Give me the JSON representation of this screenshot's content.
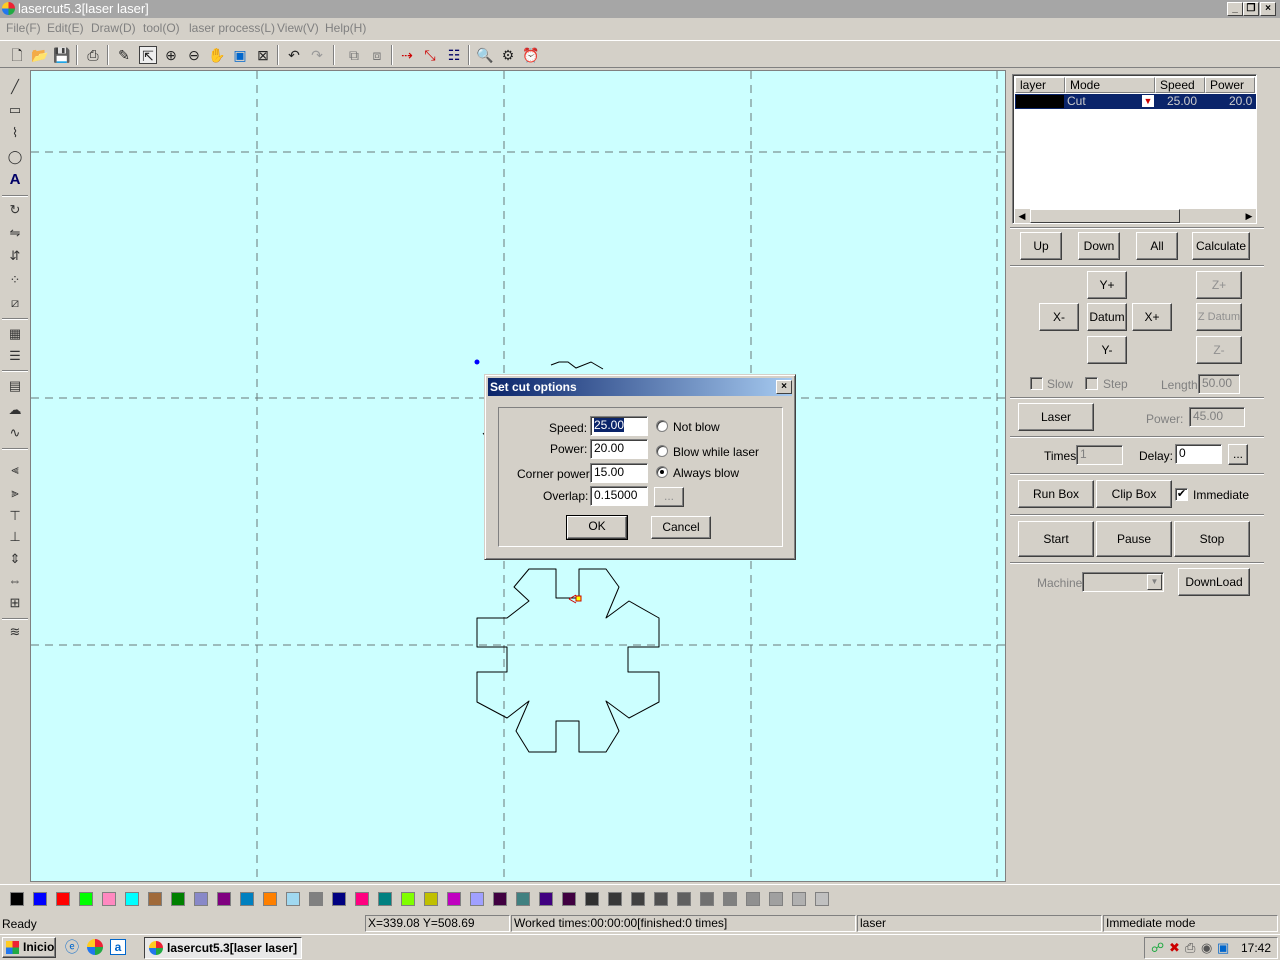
{
  "window": {
    "title": "lasercut5.3[laser laser]"
  },
  "menu": [
    "File(F)",
    "Edit(E)",
    "Draw(D)",
    "tool(O)",
    "laser process(L)",
    "View(V)",
    "Help(H)"
  ],
  "layer_table": {
    "headers": [
      "layer",
      "Mode",
      "Speed",
      "Power"
    ],
    "rows": [
      {
        "layer_color": "#000000",
        "mode": "Cut",
        "speed": "25.00",
        "power": "20.0"
      }
    ]
  },
  "controls": {
    "up": "Up",
    "down": "Down",
    "all": "All",
    "calculate": "Calculate",
    "y_plus": "Y+",
    "x_minus": "X-",
    "datum": "Datum",
    "x_plus": "X+",
    "y_minus": "Y-",
    "z_plus": "Z+",
    "z_datum": "Z Datum",
    "z_minus": "Z-",
    "slow": "Slow",
    "step": "Step",
    "length_label": "Length:",
    "length_value": "50.00",
    "laser": "Laser",
    "power_label": "Power:",
    "power_value": "45.00",
    "times_label": "Times:",
    "times_value": "1",
    "delay_label": "Delay:",
    "delay_value": "0",
    "delay_more": "...",
    "run_box": "Run Box",
    "clip_box": "Clip Box",
    "immediate": "Immediate",
    "start": "Start",
    "pause": "Pause",
    "stop": "Stop",
    "machine_label": "Machine:",
    "download": "DownLoad"
  },
  "dialog": {
    "title": "Set cut options",
    "speed_label": "Speed:",
    "speed_value": "25.00",
    "power_label": "Power:",
    "power_value": "20.00",
    "corner_power_label": "Corner power:",
    "corner_power_value": "15.00",
    "overlap_label": "Overlap:",
    "overlap_value": "0.15000",
    "more": "...",
    "not_blow": "Not blow",
    "blow_while_laser": "Blow while laser",
    "always_blow": "Always blow",
    "selected_blow": "always_blow",
    "ok": "OK",
    "cancel": "Cancel"
  },
  "status": {
    "ready": "Ready",
    "coords": "X=339.08 Y=508.69",
    "worked": "Worked times:00:00:00[finished:0 times]",
    "device": "laser",
    "mode": "Immediate mode"
  },
  "taskbar": {
    "start": "Inicio",
    "task": "lasercut5.3[laser laser]",
    "clock": "17:42"
  },
  "palette": [
    "#000000",
    "#0000ff",
    "#ff0000",
    "#00ff00",
    "#ff88c0",
    "#00ffff",
    "#a06a3a",
    "#008000",
    "#8888c8",
    "#800080",
    "#0080c0",
    "#ff8000",
    "#a0d8f0",
    "#808080",
    "#000080",
    "#ff0080",
    "#008080",
    "#80ff00",
    "#c0c000",
    "#c000c0",
    "#a0a0ff",
    "#400040",
    "#408080",
    "#400080",
    "#400040",
    "#303030",
    "#383838",
    "#404040",
    "#505050",
    "#606060",
    "#707070",
    "#808080",
    "#909090",
    "#a0a0a0",
    "#b0b0b0",
    "#c0c0c0"
  ],
  "colors": {
    "canvas": "#ccffff",
    "selection": "#0a246a"
  }
}
